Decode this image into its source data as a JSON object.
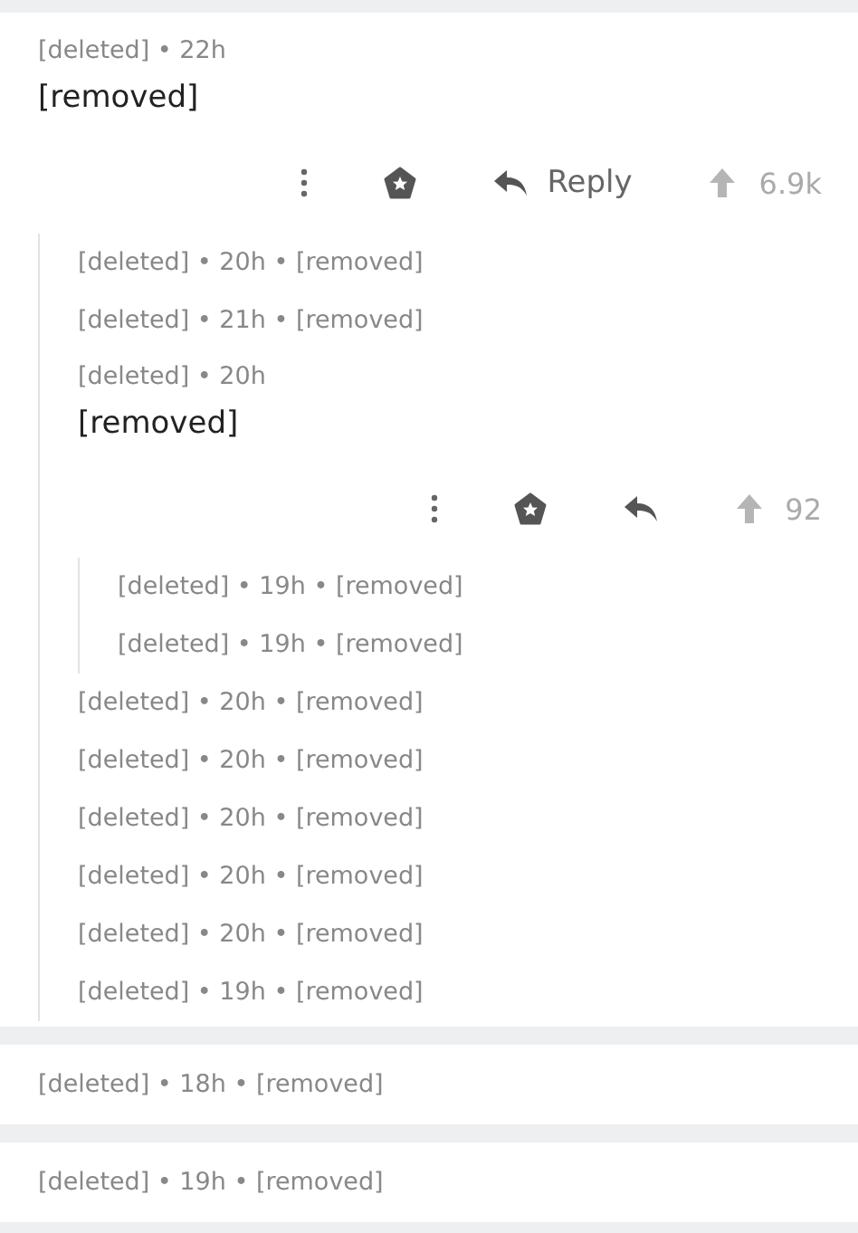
{
  "threads": [
    {
      "kind": "expanded",
      "meta": "[deleted] • 22h",
      "body": "[removed]",
      "reply_label": "Reply",
      "score": "6.9k",
      "children": [
        {
          "kind": "collapsed",
          "line": "[deleted] • 20h • [removed]"
        },
        {
          "kind": "collapsed",
          "line": "[deleted] • 21h • [removed]"
        },
        {
          "kind": "expanded",
          "meta": "[deleted] • 20h",
          "body": "[removed]",
          "score": "92",
          "children": [
            {
              "kind": "collapsed",
              "line": "[deleted] • 19h • [removed]"
            },
            {
              "kind": "collapsed",
              "line": "[deleted] • 19h • [removed]"
            }
          ]
        },
        {
          "kind": "collapsed",
          "line": "[deleted] • 20h • [removed]"
        },
        {
          "kind": "collapsed",
          "line": "[deleted] • 20h • [removed]"
        },
        {
          "kind": "collapsed",
          "line": "[deleted] • 20h • [removed]"
        },
        {
          "kind": "collapsed",
          "line": "[deleted] • 20h • [removed]"
        },
        {
          "kind": "collapsed",
          "line": "[deleted] • 20h • [removed]"
        },
        {
          "kind": "collapsed",
          "line": "[deleted] • 19h • [removed]"
        }
      ]
    },
    {
      "kind": "collapsed",
      "line": "[deleted] • 18h • [removed]"
    },
    {
      "kind": "collapsed",
      "line": "[deleted] • 19h • [removed]"
    }
  ]
}
